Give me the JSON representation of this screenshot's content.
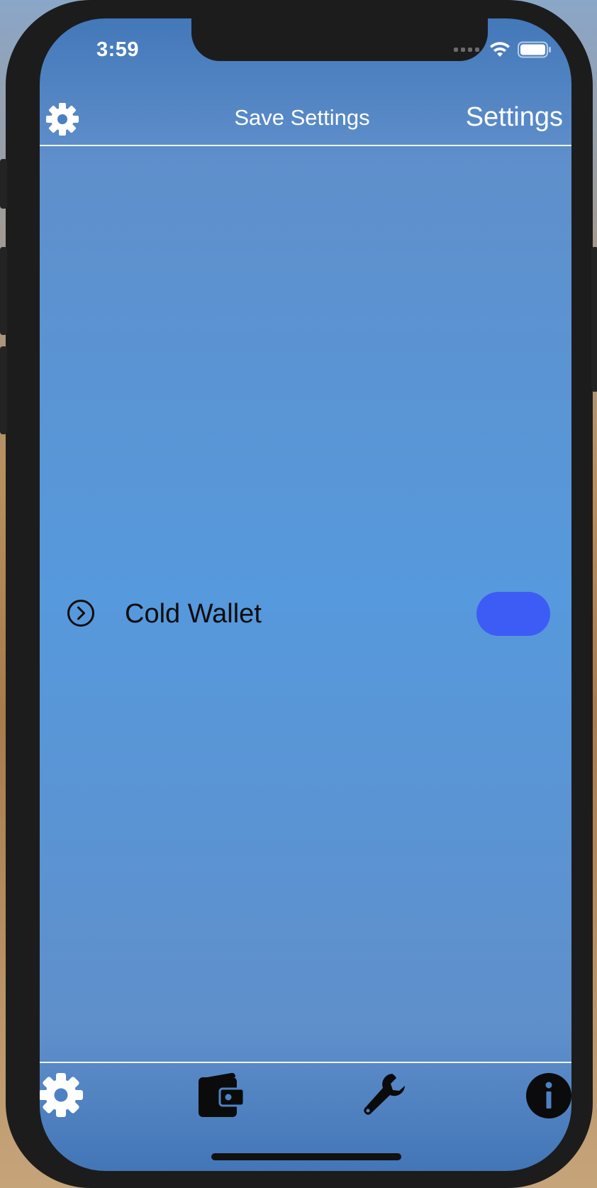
{
  "status_bar": {
    "time": "3:59",
    "icons": [
      "cellular-signal-icon",
      "wifi-icon",
      "battery-icon"
    ]
  },
  "header": {
    "left_icon": "gear-icon",
    "action_label": "Save Settings",
    "title": "Settings"
  },
  "settings_list": {
    "items": [
      {
        "icon": "chevron-right-circle-icon",
        "label": "Cold Wallet",
        "control": "toggle"
      }
    ]
  },
  "tab_bar": {
    "items": [
      {
        "icon": "gear-icon"
      },
      {
        "icon": "wallet-icon"
      },
      {
        "icon": "wrench-icon"
      },
      {
        "icon": "info-icon"
      }
    ]
  },
  "colors": {
    "screen_background": "#5699dc",
    "toggle": "#3d5cf5",
    "text_dark": "#0d0d0d",
    "text_light": "#ffffff",
    "device_frame": "#1c1c1d"
  }
}
